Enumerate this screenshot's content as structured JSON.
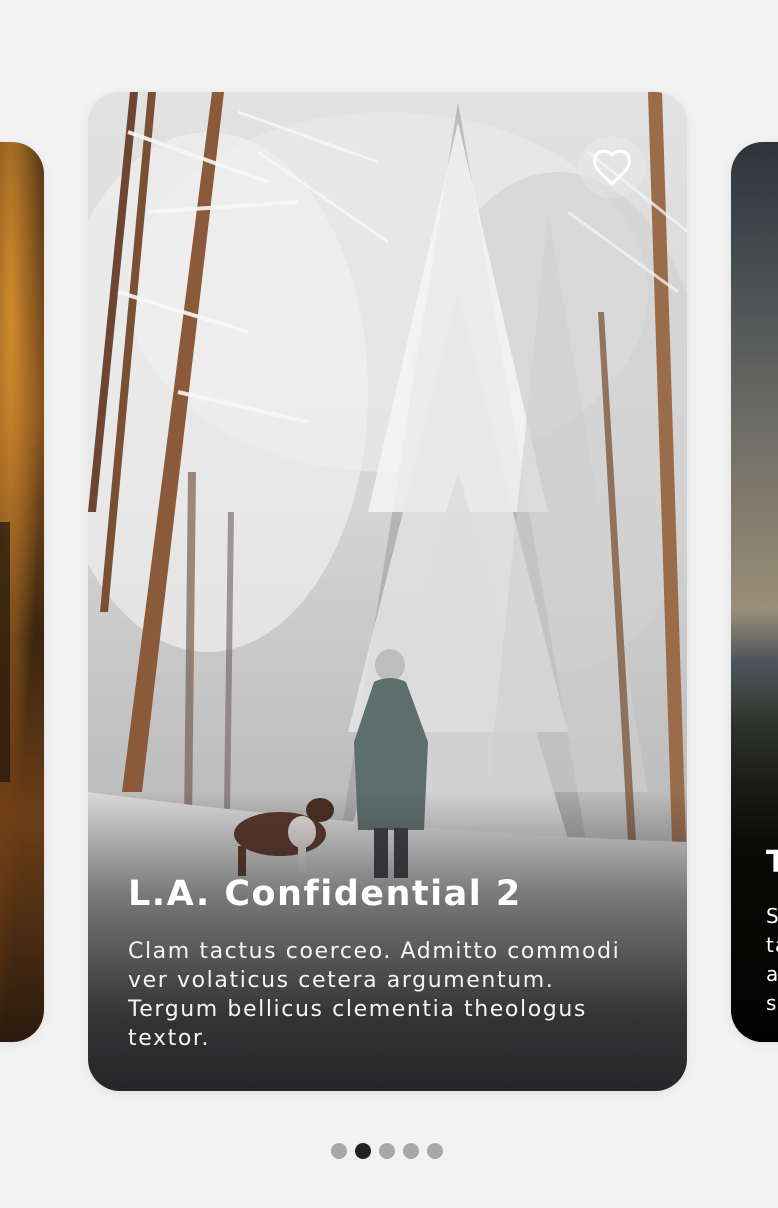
{
  "carousel": {
    "prev_card": {
      "theme": "autumn forest"
    },
    "current_card": {
      "title": "L.A. Confidential 2",
      "description": "Clam tactus coerceo. Admitto commodi ver volaticus cetera argumentum. Tergum bellicus clementia theologus textor.",
      "favorite_icon": "heart-outline-icon",
      "favorited": false
    },
    "next_card": {
      "title_partial": "T",
      "description_partial": "S\nta\na\ns"
    },
    "pagination": {
      "total": 5,
      "active_index": 1
    }
  },
  "colors": {
    "background": "#f2f2f2",
    "dot_active": "#222222",
    "dot_inactive": "#a8a8a8",
    "text": "#ffffff"
  }
}
